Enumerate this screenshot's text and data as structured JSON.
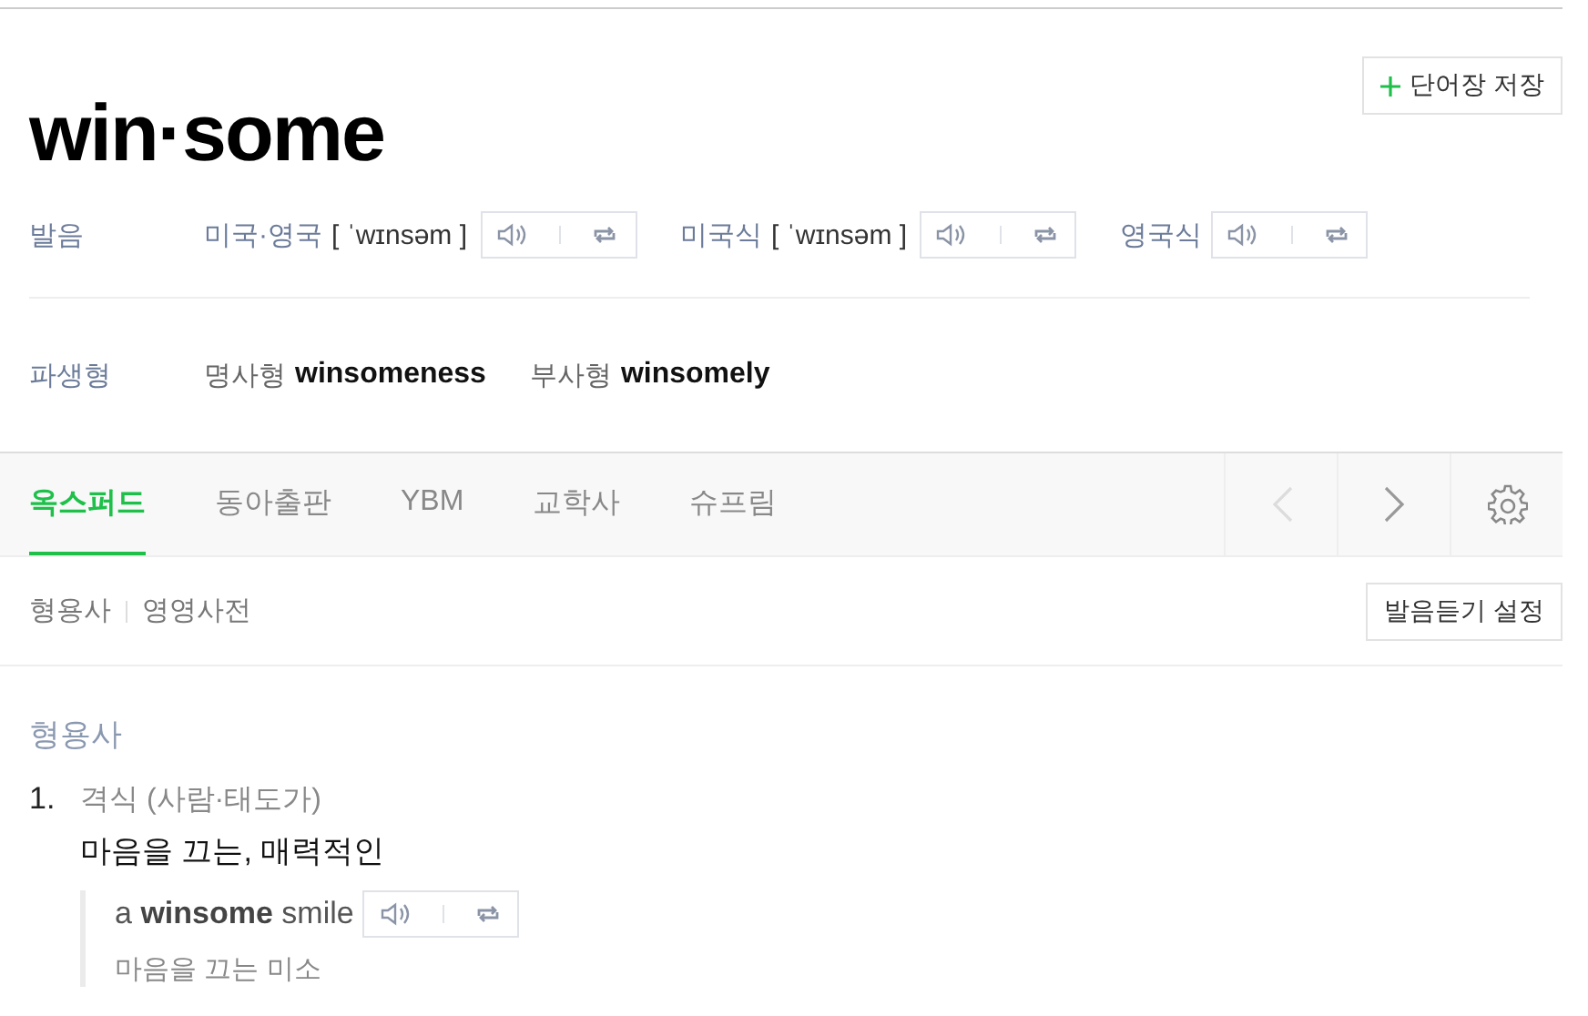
{
  "headword": "win·some",
  "save_button": {
    "label": "단어장 저장"
  },
  "pronunciation": {
    "label": "발음",
    "entries": [
      {
        "region": "미국·영국",
        "ipa": "[ ˈwɪnsəm ]"
      },
      {
        "region": "미국식",
        "ipa": "[ ˈwɪnsəm ]"
      },
      {
        "region": "영국식"
      }
    ]
  },
  "derivatives": {
    "label": "파생형",
    "items": [
      {
        "pos": "명사형",
        "word": "winsomeness"
      },
      {
        "pos": "부사형",
        "word": "winsomely"
      }
    ]
  },
  "tabs": [
    {
      "label": "옥스퍼드",
      "selected": true
    },
    {
      "label": "동아출판",
      "selected": false
    },
    {
      "label": "YBM",
      "selected": false
    },
    {
      "label": "교학사",
      "selected": false
    },
    {
      "label": "슈프림",
      "selected": false
    }
  ],
  "nav": {
    "prev_disabled": true,
    "next_disabled": false
  },
  "subnav": {
    "items": [
      "형용사",
      "영영사전"
    ],
    "button": "발음듣기 설정"
  },
  "sections": [
    {
      "pos": "형용사",
      "senses": [
        {
          "number": "1.",
          "note": "격식 (사람·태도가)",
          "meaning": "마음을 끄는, 매력적인",
          "examples": [
            {
              "text": "a **winsome** smile",
              "translation": "마음을 끄는 미소"
            }
          ]
        }
      ]
    }
  ]
}
